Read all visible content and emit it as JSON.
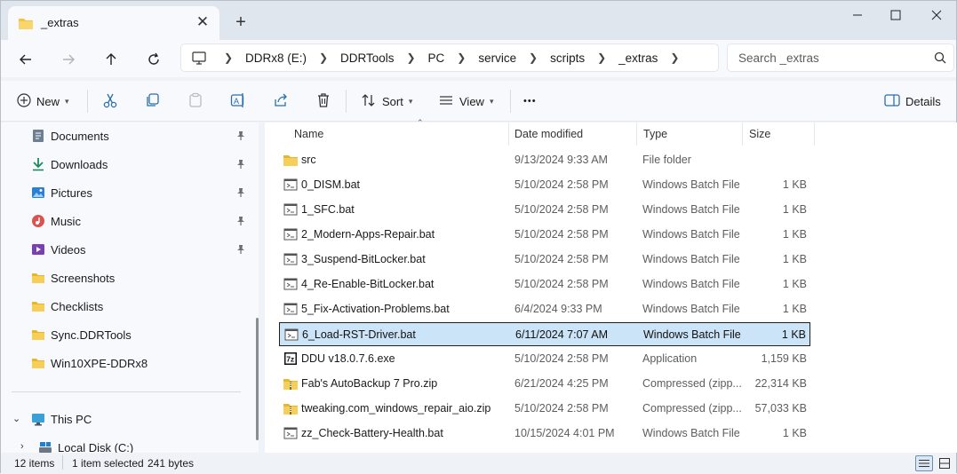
{
  "tab": {
    "title": "_extras",
    "close": "✕"
  },
  "newtab": "+",
  "breadcrumb": [
    "DDRx8 (E:)",
    "DDRTools",
    "PC",
    "service",
    "scripts",
    "_extras"
  ],
  "search": {
    "placeholder": "Search _extras"
  },
  "commands": {
    "new": "New",
    "sort": "Sort",
    "view": "View",
    "more": "•••",
    "details": "Details"
  },
  "sidebar": {
    "quick_access": [
      {
        "label": "Documents",
        "icon": "documents-icon",
        "pinned": true
      },
      {
        "label": "Downloads",
        "icon": "downloads-icon",
        "pinned": true
      },
      {
        "label": "Pictures",
        "icon": "pictures-icon",
        "pinned": true
      },
      {
        "label": "Music",
        "icon": "music-icon",
        "pinned": true
      },
      {
        "label": "Videos",
        "icon": "videos-icon",
        "pinned": true
      },
      {
        "label": "Screenshots",
        "icon": "folder-icon",
        "pinned": false
      },
      {
        "label": "Checklists",
        "icon": "folder-icon",
        "pinned": false
      },
      {
        "label": "Sync.DDRTools",
        "icon": "folder-icon",
        "pinned": false
      },
      {
        "label": "Win10XPE-DDRx8",
        "icon": "folder-icon",
        "pinned": false
      }
    ],
    "this_pc": "This PC",
    "local_disk": "Local Disk (C:)"
  },
  "columns": {
    "name": "Name",
    "date": "Date modified",
    "type": "Type",
    "size": "Size"
  },
  "files": [
    {
      "name": "src",
      "date": "9/13/2024 9:33 AM",
      "type": "File folder",
      "size": "",
      "icon": "folder-icon"
    },
    {
      "name": "0_DISM.bat",
      "date": "5/10/2024 2:58 PM",
      "type": "Windows Batch File",
      "size": "1 KB",
      "icon": "batch-file-icon"
    },
    {
      "name": "1_SFC.bat",
      "date": "5/10/2024 2:58 PM",
      "type": "Windows Batch File",
      "size": "1 KB",
      "icon": "batch-file-icon"
    },
    {
      "name": "2_Modern-Apps-Repair.bat",
      "date": "5/10/2024 2:58 PM",
      "type": "Windows Batch File",
      "size": "1 KB",
      "icon": "batch-file-icon"
    },
    {
      "name": "3_Suspend-BitLocker.bat",
      "date": "5/10/2024 2:58 PM",
      "type": "Windows Batch File",
      "size": "1 KB",
      "icon": "batch-file-icon"
    },
    {
      "name": "4_Re-Enable-BitLocker.bat",
      "date": "5/10/2024 2:58 PM",
      "type": "Windows Batch File",
      "size": "1 KB",
      "icon": "batch-file-icon"
    },
    {
      "name": "5_Fix-Activation-Problems.bat",
      "date": "6/4/2024 9:33 PM",
      "type": "Windows Batch File",
      "size": "1 KB",
      "icon": "batch-file-icon"
    },
    {
      "name": "6_Load-RST-Driver.bat",
      "date": "6/11/2024 7:07 AM",
      "type": "Windows Batch File",
      "size": "1 KB",
      "icon": "batch-file-icon",
      "selected": true
    },
    {
      "name": "DDU v18.0.7.6.exe",
      "date": "5/10/2024 2:58 PM",
      "type": "Application",
      "size": "1,159 KB",
      "icon": "app-7z-icon"
    },
    {
      "name": "Fab's AutoBackup 7 Pro.zip",
      "date": "6/21/2024 4:25 PM",
      "type": "Compressed (zipp...",
      "size": "22,314 KB",
      "icon": "zip-folder-icon"
    },
    {
      "name": "tweaking.com_windows_repair_aio.zip",
      "date": "5/10/2024 2:58 PM",
      "type": "Compressed (zipp...",
      "size": "57,033 KB",
      "icon": "zip-folder-icon"
    },
    {
      "name": "zz_Check-Battery-Health.bat",
      "date": "10/15/2024 4:01 PM",
      "type": "Windows Batch File",
      "size": "1 KB",
      "icon": "batch-file-icon"
    }
  ],
  "status": {
    "count": "12 items",
    "selection": "1 item selected",
    "size": "241 bytes"
  },
  "colors": {
    "selection": "#cce4f7",
    "folder": "#f4c542",
    "accent": "#0067c0"
  }
}
